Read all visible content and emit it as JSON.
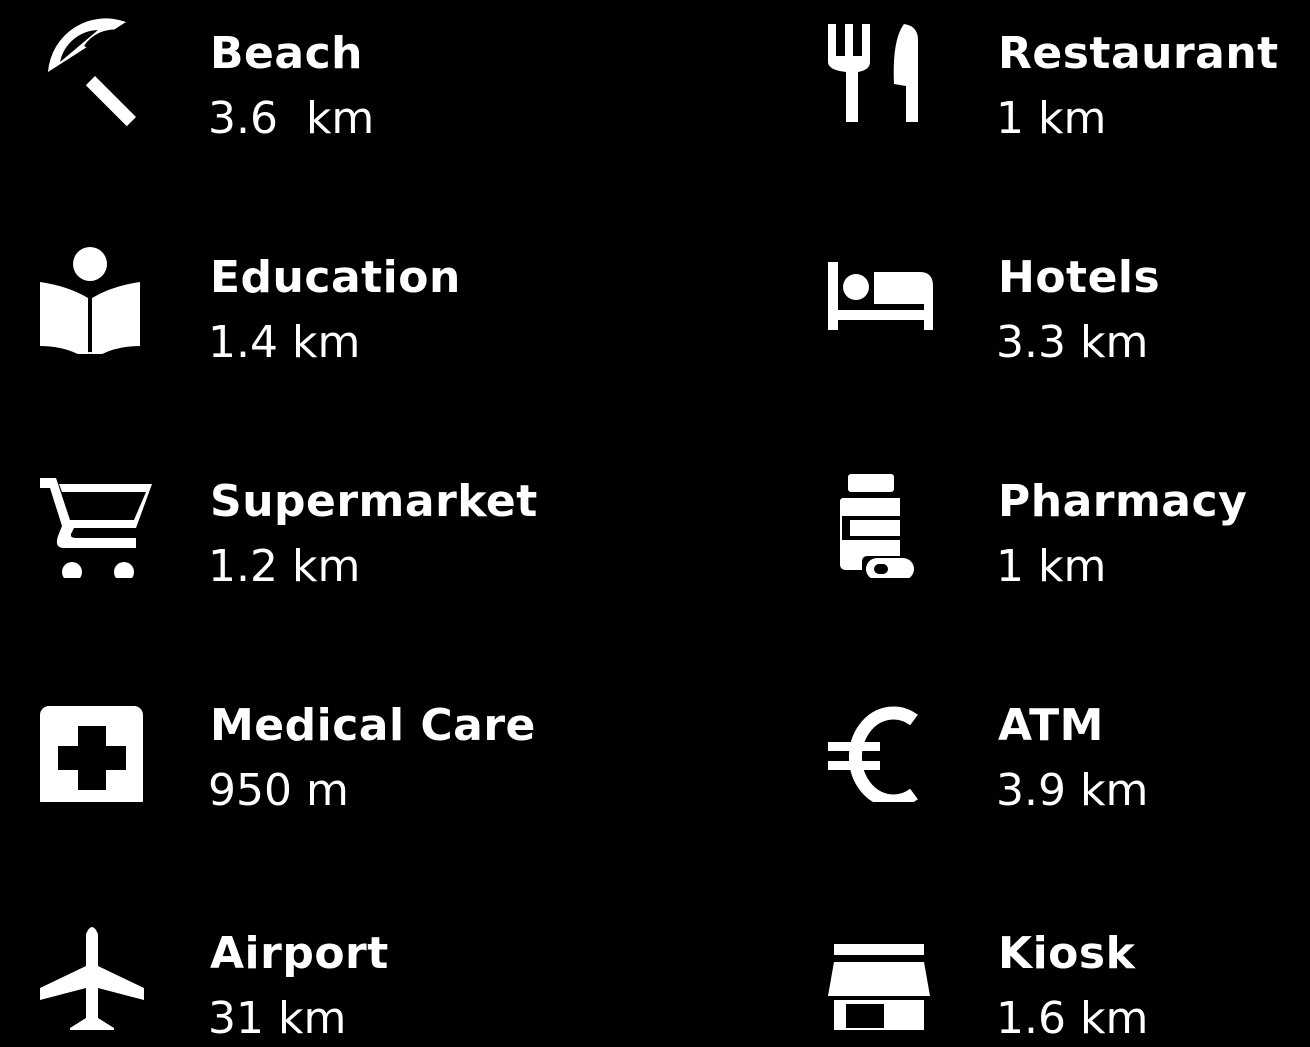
{
  "colors": {
    "background": "#000000",
    "foreground": "#ffffff"
  },
  "amenities": [
    {
      "label": "Beach",
      "distance": "3.6  km",
      "icon": "beach-umbrella-icon"
    },
    {
      "label": "Restaurant",
      "distance": "1 km",
      "icon": "fork-knife-icon"
    },
    {
      "label": "Education",
      "distance": "1.4 km",
      "icon": "reading-person-icon"
    },
    {
      "label": "Hotels",
      "distance": "3.3 km",
      "icon": "bed-icon"
    },
    {
      "label": "Supermarket",
      "distance": "1.2 km",
      "icon": "shopping-cart-icon"
    },
    {
      "label": "Pharmacy",
      "distance": "1 km",
      "icon": "medicine-bottle-icon"
    },
    {
      "label": "Medical Care",
      "distance": "950 m",
      "icon": "medical-cross-icon"
    },
    {
      "label": "ATM",
      "distance": "3.9 km",
      "icon": "euro-icon"
    },
    {
      "label": "Airport",
      "distance": "31 km",
      "icon": "airplane-icon"
    },
    {
      "label": "Kiosk",
      "distance": "1.6 km",
      "icon": "storefront-icon"
    }
  ]
}
